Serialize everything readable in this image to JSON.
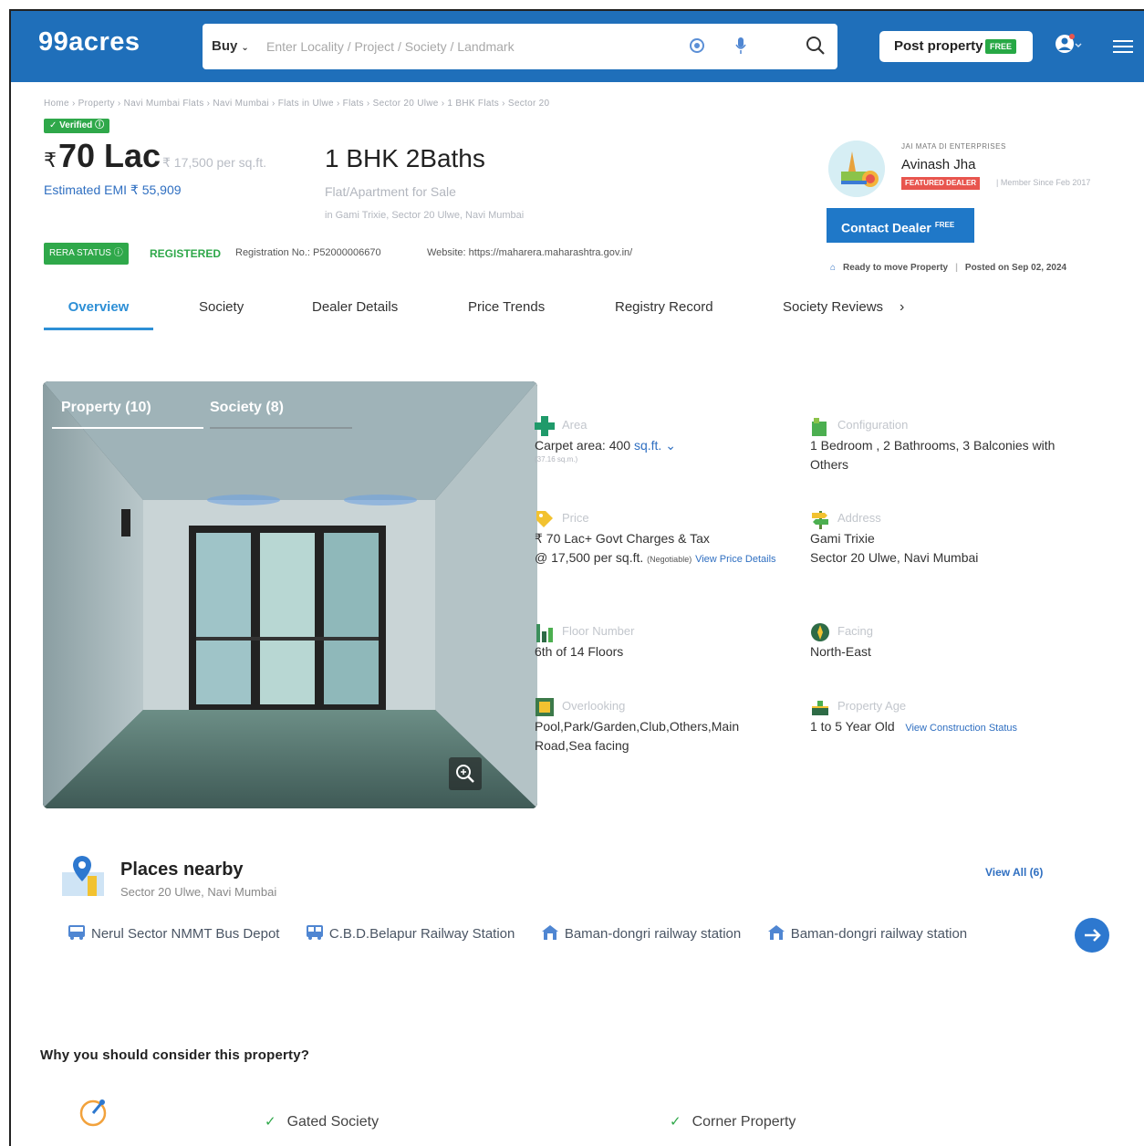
{
  "header": {
    "logo": "99acres",
    "search_type": "Buy",
    "search_placeholder": "Enter Locality / Project / Society / Landmark",
    "post_property": "Post property",
    "post_free_badge": "FREE"
  },
  "breadcrumb": "Home › Property › Navi Mumbai Flats › Navi Mumbai › Flats in Ulwe › Flats › Sector 20 Ulwe › 1 BHK Flats › Sector 20",
  "listing": {
    "verified": "✓ Verified ⓘ",
    "price_rupee": "₹",
    "price": "70 Lac",
    "price_per_sqft": "₹ 17,500 per sq.ft.",
    "emi": "Estimated EMI ₹ 55,909",
    "title": "1 BHK 2Baths",
    "type": "Flat/Apartment for Sale",
    "address": "in Gami Trixie, Sector 20 Ulwe, Navi Mumbai",
    "rera_status": "RERA STATUS ⓘ",
    "registered": "REGISTERED",
    "registration_no": "Registration No.: P52000006670",
    "website": "Website: https://maharera.maharashtra.gov.in/"
  },
  "dealer": {
    "company": "JAI MATA DI ENTERPRISES",
    "name": "Avinash Jha",
    "featured": "FEATURED DEALER",
    "member_since": "| Member Since Feb 2017",
    "contact_label": "Contact Dealer",
    "contact_free": "FREE",
    "ready": "Ready to move Property",
    "posted": "Posted on Sep 02, 2024"
  },
  "tabs": [
    {
      "label": "Overview"
    },
    {
      "label": "Society"
    },
    {
      "label": "Dealer Details"
    },
    {
      "label": "Price Trends"
    },
    {
      "label": "Registry Record"
    },
    {
      "label": "Society Reviews"
    }
  ],
  "gallery": {
    "tab_property": "Property (10)",
    "tab_society": "Society (8)"
  },
  "details": {
    "area_label": "Area",
    "area_value": "Carpet area: 400",
    "area_unit": "sq.ft.",
    "area_sub": "(37.16 sq.m.)",
    "config_label": "Configuration",
    "config_value": "1 Bedroom , 2 Bathrooms, 3 Balconies with Others",
    "price_label": "Price",
    "price_line1": "₹ 70 Lac+ Govt Charges & Tax",
    "price_line2": "@ 17,500 per sq.ft.",
    "price_negotiable": "(Negotiable)",
    "price_link": "View Price Details",
    "address_label": "Address",
    "address_line1": "Gami Trixie",
    "address_line2": "Sector 20 Ulwe, Navi Mumbai",
    "floor_label": "Floor Number",
    "floor_value": "6th of 14 Floors",
    "facing_label": "Facing",
    "facing_value": "North-East",
    "overlooking_label": "Overlooking",
    "overlooking_value": "Pool,Park/Garden,Club,Others,Main Road,Sea facing",
    "age_label": "Property Age",
    "age_value": "1 to 5 Year Old",
    "age_link": "View Construction Status"
  },
  "places": {
    "title": "Places nearby",
    "subtitle": "Sector 20 Ulwe, Navi Mumbai",
    "view_all": "View All (6)",
    "items": [
      {
        "label": "Nerul Sector NMMT Bus Depot",
        "icon": "bus-icon"
      },
      {
        "label": "C.B.D.Belapur Railway Station",
        "icon": "train-icon"
      },
      {
        "label": "Baman-dongri railway station",
        "icon": "station-icon"
      },
      {
        "label": "Baman-dongri railway station",
        "icon": "station-icon"
      }
    ]
  },
  "why": {
    "title": "Why you should consider this property?",
    "features": [
      "Gated Society",
      "Corner Property"
    ]
  },
  "colors": {
    "brand": "#1f6fba",
    "green": "#2fa84a",
    "link": "#2f6fc1"
  }
}
